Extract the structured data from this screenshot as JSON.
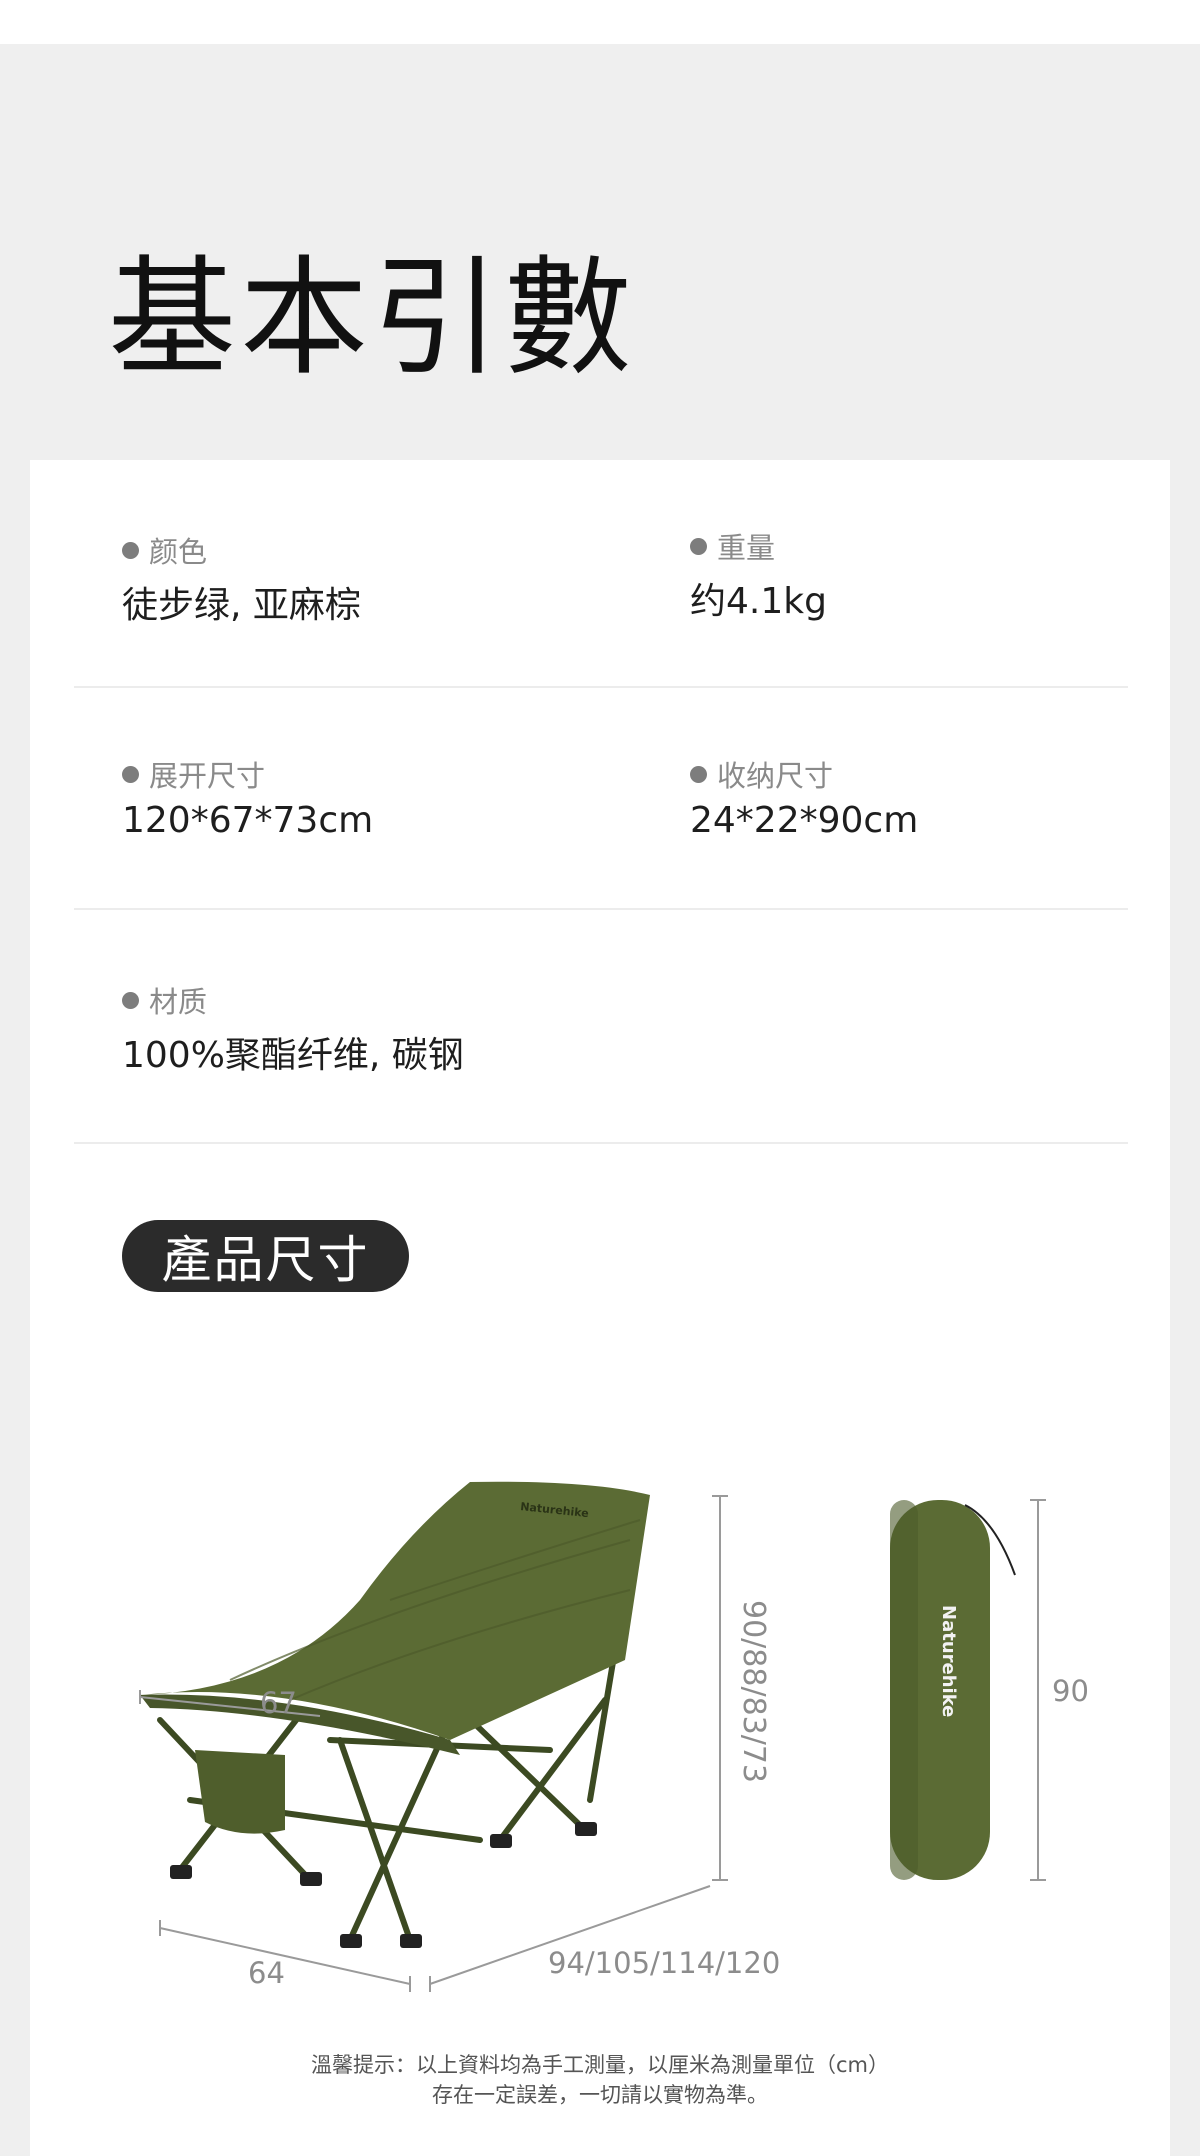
{
  "header": {
    "title": "基本引數"
  },
  "specs": [
    {
      "label": "颜色",
      "value": "徒步绿, 亚麻棕"
    },
    {
      "label": "重量",
      "value": "约4.1kg"
    },
    {
      "label": "展开尺寸",
      "value": "120*67*73cm"
    },
    {
      "label": "收纳尺寸",
      "value": "24*22*90cm"
    },
    {
      "label": "材质",
      "value": "100%聚酯纤维, 碳钢"
    }
  ],
  "section": {
    "title": "產品尺寸"
  },
  "product": {
    "brand_chair": "Naturehike",
    "brand_bag": "Naturehike",
    "dimensions": {
      "width": "67",
      "depth": "64",
      "length": "94/105/114/120",
      "height": "90/88/83/73",
      "bag_height": "90"
    },
    "colors": {
      "green": "#5b6b34",
      "green_dark": "#48562a",
      "frame": "#3c4a22"
    }
  },
  "footnote": {
    "line1": "溫馨提示：以上資料均為手工測量，以厘米為測量單位（cm）",
    "line2": "存在一定誤差，一切請以實物為準。"
  }
}
